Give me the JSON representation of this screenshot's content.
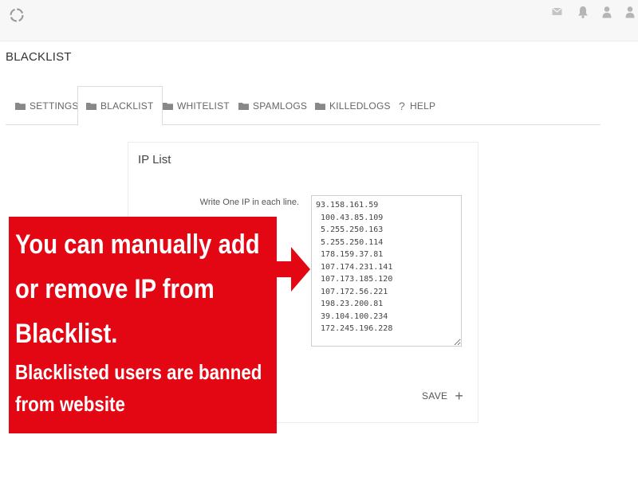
{
  "app": {
    "logo_icon": "circle-spinner-logo-icon"
  },
  "header_icons": [
    "mail-icon",
    "bell-icon",
    "user-icon",
    "user-icon"
  ],
  "page_title": "BLACKLIST",
  "tabs": [
    {
      "label": "SETTINGS",
      "icon": "folder-icon",
      "active": false
    },
    {
      "label": "BLACKLIST",
      "icon": "folder-icon",
      "active": true
    },
    {
      "label": "WHITELIST",
      "icon": "folder-icon",
      "active": false
    },
    {
      "label": "SPAMLOGS",
      "icon": "folder-icon",
      "active": false
    },
    {
      "label": "KILLEDLOGS",
      "icon": "folder-icon",
      "active": false
    },
    {
      "label": "HELP",
      "icon": "question-icon",
      "active": false
    }
  ],
  "card": {
    "title": "IP List",
    "field_label": "Write One IP in each line.",
    "ip_list": "93.158.161.59\n 100.43.85.109\n 5.255.250.163\n 5.255.250.114\n 178.159.37.81\n 107.174.231.141\n 107.173.185.120\n 107.172.56.221\n 198.23.200.81\n 39.104.100.234\n 172.245.196.228",
    "save_label": "SAVE"
  },
  "callout": {
    "line1": "You can manually add",
    "line2": "or remove IP from",
    "line3": "Blacklist.",
    "line4": "Blacklisted users are banned",
    "line5": "from website"
  },
  "colors": {
    "callout_red": "#e30613",
    "topbar_bg": "#f7f7f7",
    "icon_gray": "#b5b5b5"
  }
}
